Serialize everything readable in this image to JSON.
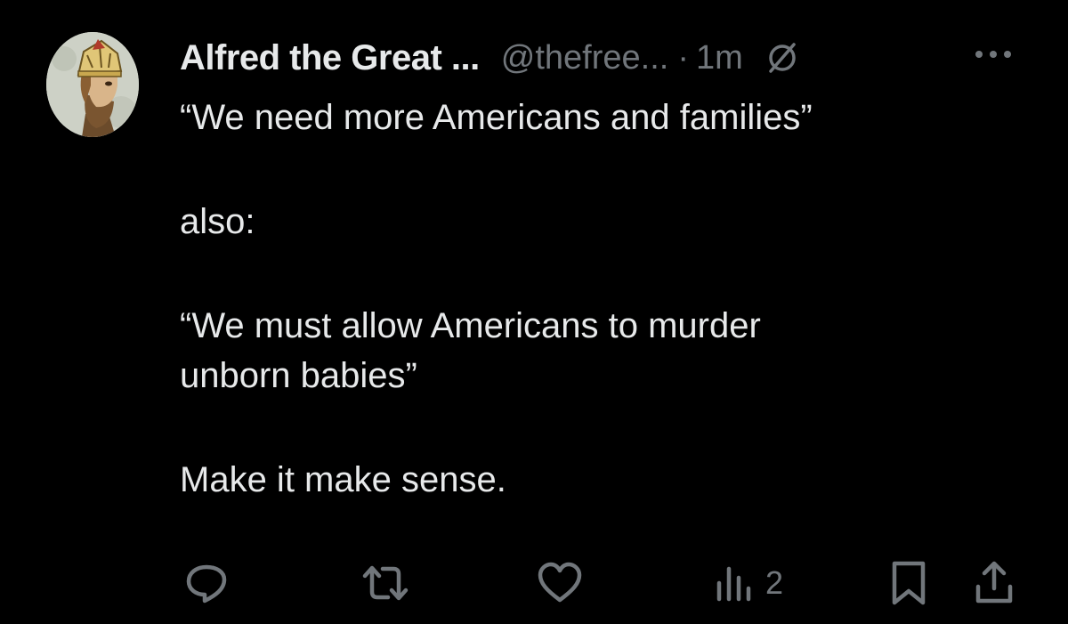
{
  "post": {
    "author": {
      "display_name": "Alfred the Great ...",
      "handle": "@thefree...",
      "avatar_icon": "king-portrait-avatar"
    },
    "separator": "·",
    "time": "1m",
    "status_icon": "muted-circle-slash-icon",
    "more_icon": "ellipsis-icon",
    "text": {
      "line1": "“We need more Americans and families”",
      "line2": "also:",
      "line3": "“We must allow Americans to murder",
      "line4": "unborn babies”",
      "line5": "Make it make sense."
    },
    "actions": {
      "reply_icon": "reply-icon",
      "repost_icon": "repost-icon",
      "like_icon": "heart-icon",
      "views_icon": "views-bar-chart-icon",
      "views_count": "2",
      "bookmark_icon": "bookmark-icon",
      "share_icon": "share-icon"
    }
  },
  "colors": {
    "background": "#000000",
    "primary_text": "#e7e9ea",
    "secondary_text": "#71767b"
  }
}
